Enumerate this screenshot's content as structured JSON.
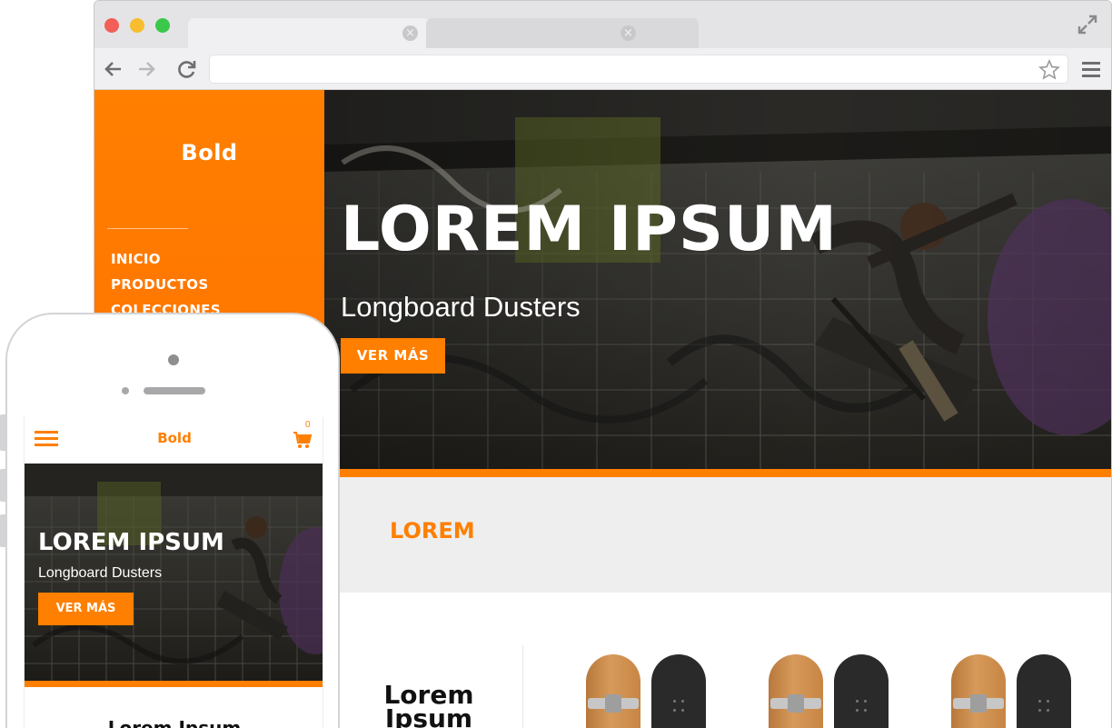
{
  "colors": {
    "accent": "#ff7f00",
    "band": "#eeeeee",
    "chrome": "#e4e4e6"
  },
  "browser": {
    "address_value": "",
    "icons": [
      "back-arrow-icon",
      "forward-arrow-icon",
      "reload-icon",
      "star-icon",
      "menu-icon",
      "expand-icon",
      "tab-close-icon"
    ]
  },
  "site": {
    "logo": "Bold",
    "nav": [
      "INICIO",
      "PRODUCTOS",
      "COLECCIONES"
    ],
    "hero": {
      "title": "LOREM IPSUM",
      "subtitle": "Longboard Dusters",
      "button": "VER MÁS"
    },
    "section_title": "LOREM",
    "products_heading_line1": "Lorem",
    "products_heading_line2": "Ipsum"
  },
  "mobile": {
    "logo": "Bold",
    "cart_count": "0",
    "hero": {
      "title": "LOREM IPSUM",
      "subtitle": "Longboard Dusters",
      "button": "VER MÁS"
    },
    "heading": "Lorem Ipsum"
  }
}
